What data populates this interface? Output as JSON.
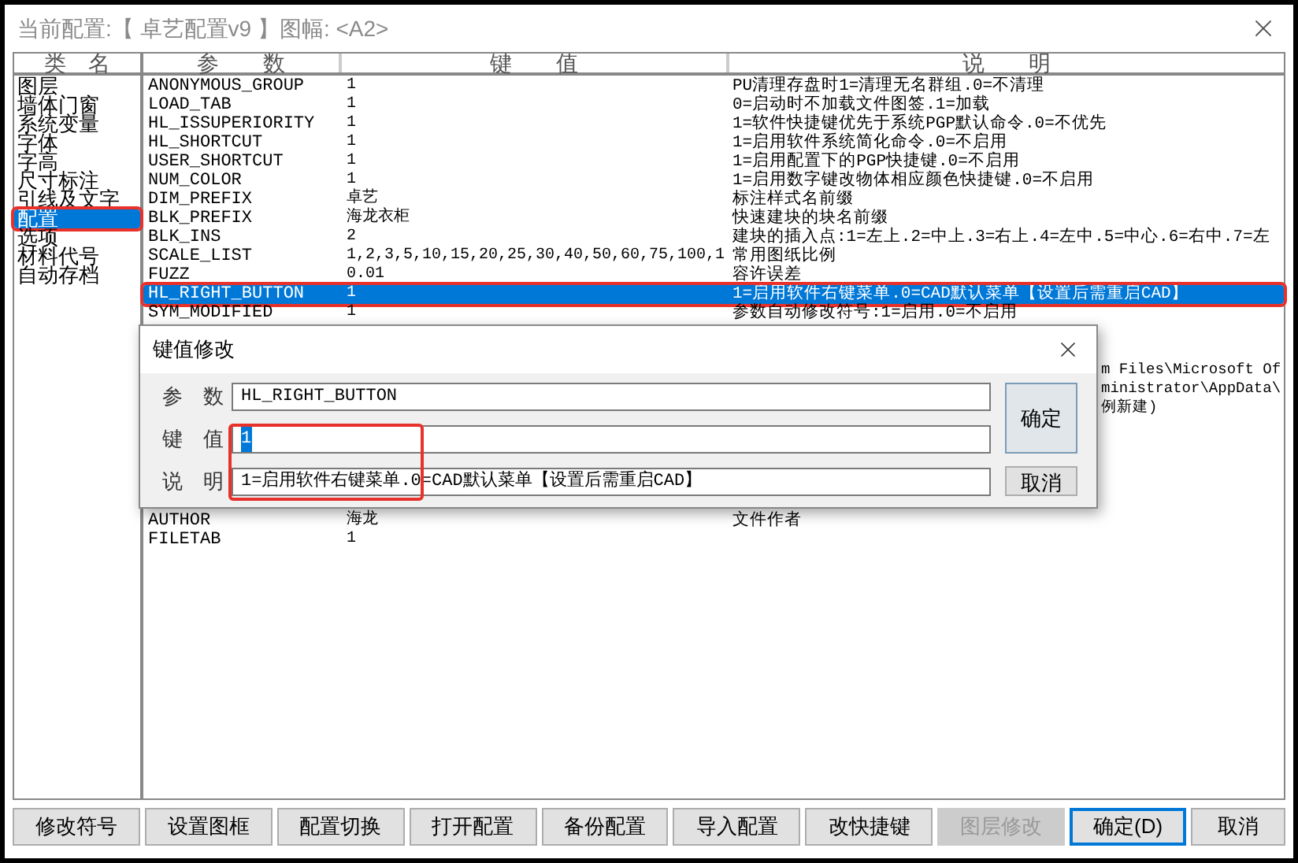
{
  "window": {
    "title": "当前配置:【 卓艺配置v9 】图幅: <A2>"
  },
  "categories": {
    "header": "类　名",
    "items": [
      {
        "label": "图层",
        "selected": false,
        "highlighted": false
      },
      {
        "label": "墙体门窗",
        "selected": false,
        "highlighted": false
      },
      {
        "label": "系统变量",
        "selected": false,
        "highlighted": false
      },
      {
        "label": "字体",
        "selected": false,
        "highlighted": false
      },
      {
        "label": "字高",
        "selected": false,
        "highlighted": false
      },
      {
        "label": "尺寸标注",
        "selected": false,
        "highlighted": false
      },
      {
        "label": "引线及文字",
        "selected": false,
        "highlighted": false
      },
      {
        "label": "配置",
        "selected": true,
        "highlighted": true
      },
      {
        "label": "选项",
        "selected": false,
        "highlighted": false
      },
      {
        "label": "材料代号",
        "selected": false,
        "highlighted": false
      },
      {
        "label": "自动存档",
        "selected": false,
        "highlighted": false
      }
    ]
  },
  "table": {
    "columns": [
      "参　　数",
      "键　　值",
      "说　　明"
    ],
    "rows": [
      {
        "kind": "full",
        "param": "ANONYMOUS_GROUP",
        "value": "1",
        "desc": "PU清理存盘时1=清理无名群组.0=不清理",
        "selected": false,
        "highlighted": false
      },
      {
        "kind": "full",
        "param": "LOAD_TAB",
        "value": "1",
        "desc": "0=启动时不加载文件图签.1=加载",
        "selected": false,
        "highlighted": false
      },
      {
        "kind": "full",
        "param": "HL_ISSUPERIORITY",
        "value": "1",
        "desc": "1=软件快捷键优先于系统PGP默认命令.0=不优先",
        "selected": false,
        "highlighted": false
      },
      {
        "kind": "full",
        "param": "HL_SHORTCUT",
        "value": "1",
        "desc": "1=启用软件系统简化命令.0=不启用",
        "selected": false,
        "highlighted": false
      },
      {
        "kind": "full",
        "param": "USER_SHORTCUT",
        "value": "1",
        "desc": "1=启用配置下的PGP快捷键.0=不启用",
        "selected": false,
        "highlighted": false
      },
      {
        "kind": "full",
        "param": "NUM_COLOR",
        "value": "1",
        "desc": "1=启用数字键改物体相应颜色快捷键.0=不启用",
        "selected": false,
        "highlighted": false
      },
      {
        "kind": "full",
        "param": "DIM_PREFIX",
        "value": "卓艺",
        "desc": "标注样式名前缀",
        "selected": false,
        "highlighted": false
      },
      {
        "kind": "full",
        "param": "BLK_PREFIX",
        "value": "海龙衣柜",
        "desc": "快速建块的块名前缀",
        "selected": false,
        "highlighted": false
      },
      {
        "kind": "full",
        "param": "BLK_INS",
        "value": "2",
        "desc": "建块的插入点:1=左上.2=中上.3=右上.4=左中.5=中心.6=右中.7=左",
        "selected": false,
        "highlighted": false
      },
      {
        "kind": "full",
        "param": "SCALE_LIST",
        "value": "1,2,3,5,10,15,20,25,30,40,50,60,75,100,1",
        "desc": "常用图纸比例",
        "selected": false,
        "highlighted": false
      },
      {
        "kind": "full",
        "param": "FUZZ",
        "value": "0.01",
        "desc": "容许误差",
        "selected": false,
        "highlighted": false
      },
      {
        "kind": "full",
        "param": "HL_RIGHT_BUTTON",
        "value": "1",
        "desc": "1=启用软件右键菜单.0=CAD默认菜单【设置后需重启CAD】",
        "selected": true,
        "highlighted": true
      },
      {
        "kind": "full",
        "param": "SYM_MODIFIED",
        "value": "1",
        "desc": "参数自动修改符号:1=启用.0=不启用",
        "selected": false,
        "highlighted": false
      },
      {
        "kind": "covered"
      },
      {
        "kind": "covered"
      },
      {
        "kind": "covered",
        "desc": "m Files\\Microsoft Of"
      },
      {
        "kind": "covered",
        "desc": "ministrator\\AppData\\"
      },
      {
        "kind": "covered",
        "desc": "例新建)"
      },
      {
        "kind": "covered"
      },
      {
        "kind": "covered"
      },
      {
        "kind": "covered"
      },
      {
        "kind": "covered"
      },
      {
        "kind": "covered"
      },
      {
        "kind": "full",
        "param": "AUTHOR",
        "value": "海龙",
        "desc": "文件作者",
        "selected": false,
        "highlighted": false
      },
      {
        "kind": "full",
        "param": "FILETAB",
        "value": "1",
        "selected": false,
        "highlighted": false
      }
    ]
  },
  "dialog": {
    "title": "键值修改",
    "fields": [
      {
        "label": "参　数",
        "value": "HL_RIGHT_BUTTON",
        "selected": false
      },
      {
        "label": "键　值",
        "value": "1",
        "selected": true
      },
      {
        "label": "说　明",
        "value": "1=启用软件右键菜单.0=CAD默认菜单【设置后需重启CAD】",
        "selected": false
      }
    ],
    "ok": "确定",
    "cancel": "取消"
  },
  "buttons": [
    {
      "label": "修改符号",
      "disabled": false,
      "focused": false
    },
    {
      "label": "设置图框",
      "disabled": false,
      "focused": false
    },
    {
      "label": "配置切换",
      "disabled": false,
      "focused": false
    },
    {
      "label": "打开配置",
      "disabled": false,
      "focused": false
    },
    {
      "label": "备份配置",
      "disabled": false,
      "focused": false
    },
    {
      "label": "导入配置",
      "disabled": false,
      "focused": false
    },
    {
      "label": "改快捷键",
      "disabled": false,
      "focused": false
    },
    {
      "label": "图层修改",
      "disabled": true,
      "focused": false
    },
    {
      "label": "确定(D)",
      "disabled": false,
      "focused": true
    },
    {
      "label": "取消",
      "disabled": false,
      "focused": false
    }
  ]
}
